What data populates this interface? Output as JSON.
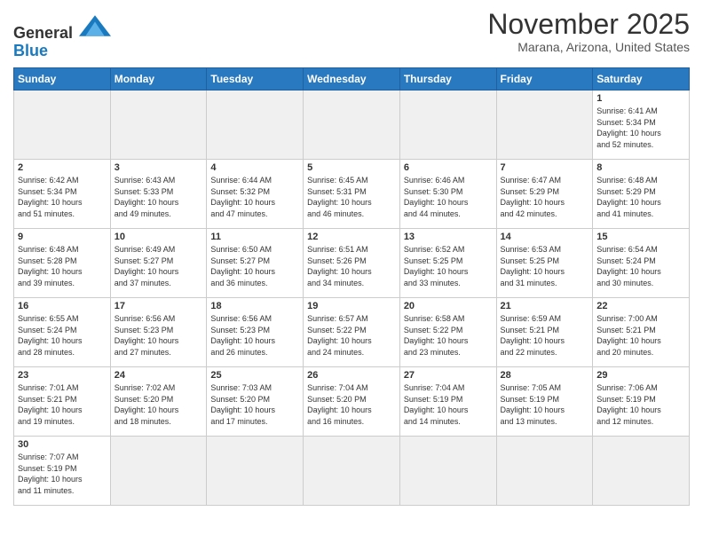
{
  "header": {
    "logo_general": "General",
    "logo_blue": "Blue",
    "month_title": "November 2025",
    "location": "Marana, Arizona, United States"
  },
  "days_of_week": [
    "Sunday",
    "Monday",
    "Tuesday",
    "Wednesday",
    "Thursday",
    "Friday",
    "Saturday"
  ],
  "weeks": [
    [
      {
        "day": null,
        "info": null
      },
      {
        "day": null,
        "info": null
      },
      {
        "day": null,
        "info": null
      },
      {
        "day": null,
        "info": null
      },
      {
        "day": null,
        "info": null
      },
      {
        "day": null,
        "info": null
      },
      {
        "day": "1",
        "info": "Sunrise: 6:41 AM\nSunset: 5:34 PM\nDaylight: 10 hours\nand 52 minutes."
      }
    ],
    [
      {
        "day": "2",
        "info": "Sunrise: 6:42 AM\nSunset: 5:34 PM\nDaylight: 10 hours\nand 51 minutes."
      },
      {
        "day": "3",
        "info": "Sunrise: 6:43 AM\nSunset: 5:33 PM\nDaylight: 10 hours\nand 49 minutes."
      },
      {
        "day": "4",
        "info": "Sunrise: 6:44 AM\nSunset: 5:32 PM\nDaylight: 10 hours\nand 47 minutes."
      },
      {
        "day": "5",
        "info": "Sunrise: 6:45 AM\nSunset: 5:31 PM\nDaylight: 10 hours\nand 46 minutes."
      },
      {
        "day": "6",
        "info": "Sunrise: 6:46 AM\nSunset: 5:30 PM\nDaylight: 10 hours\nand 44 minutes."
      },
      {
        "day": "7",
        "info": "Sunrise: 6:47 AM\nSunset: 5:29 PM\nDaylight: 10 hours\nand 42 minutes."
      },
      {
        "day": "8",
        "info": "Sunrise: 6:48 AM\nSunset: 5:29 PM\nDaylight: 10 hours\nand 41 minutes."
      }
    ],
    [
      {
        "day": "9",
        "info": "Sunrise: 6:48 AM\nSunset: 5:28 PM\nDaylight: 10 hours\nand 39 minutes."
      },
      {
        "day": "10",
        "info": "Sunrise: 6:49 AM\nSunset: 5:27 PM\nDaylight: 10 hours\nand 37 minutes."
      },
      {
        "day": "11",
        "info": "Sunrise: 6:50 AM\nSunset: 5:27 PM\nDaylight: 10 hours\nand 36 minutes."
      },
      {
        "day": "12",
        "info": "Sunrise: 6:51 AM\nSunset: 5:26 PM\nDaylight: 10 hours\nand 34 minutes."
      },
      {
        "day": "13",
        "info": "Sunrise: 6:52 AM\nSunset: 5:25 PM\nDaylight: 10 hours\nand 33 minutes."
      },
      {
        "day": "14",
        "info": "Sunrise: 6:53 AM\nSunset: 5:25 PM\nDaylight: 10 hours\nand 31 minutes."
      },
      {
        "day": "15",
        "info": "Sunrise: 6:54 AM\nSunset: 5:24 PM\nDaylight: 10 hours\nand 30 minutes."
      }
    ],
    [
      {
        "day": "16",
        "info": "Sunrise: 6:55 AM\nSunset: 5:24 PM\nDaylight: 10 hours\nand 28 minutes."
      },
      {
        "day": "17",
        "info": "Sunrise: 6:56 AM\nSunset: 5:23 PM\nDaylight: 10 hours\nand 27 minutes."
      },
      {
        "day": "18",
        "info": "Sunrise: 6:56 AM\nSunset: 5:23 PM\nDaylight: 10 hours\nand 26 minutes."
      },
      {
        "day": "19",
        "info": "Sunrise: 6:57 AM\nSunset: 5:22 PM\nDaylight: 10 hours\nand 24 minutes."
      },
      {
        "day": "20",
        "info": "Sunrise: 6:58 AM\nSunset: 5:22 PM\nDaylight: 10 hours\nand 23 minutes."
      },
      {
        "day": "21",
        "info": "Sunrise: 6:59 AM\nSunset: 5:21 PM\nDaylight: 10 hours\nand 22 minutes."
      },
      {
        "day": "22",
        "info": "Sunrise: 7:00 AM\nSunset: 5:21 PM\nDaylight: 10 hours\nand 20 minutes."
      }
    ],
    [
      {
        "day": "23",
        "info": "Sunrise: 7:01 AM\nSunset: 5:21 PM\nDaylight: 10 hours\nand 19 minutes."
      },
      {
        "day": "24",
        "info": "Sunrise: 7:02 AM\nSunset: 5:20 PM\nDaylight: 10 hours\nand 18 minutes."
      },
      {
        "day": "25",
        "info": "Sunrise: 7:03 AM\nSunset: 5:20 PM\nDaylight: 10 hours\nand 17 minutes."
      },
      {
        "day": "26",
        "info": "Sunrise: 7:04 AM\nSunset: 5:20 PM\nDaylight: 10 hours\nand 16 minutes."
      },
      {
        "day": "27",
        "info": "Sunrise: 7:04 AM\nSunset: 5:19 PM\nDaylight: 10 hours\nand 14 minutes."
      },
      {
        "day": "28",
        "info": "Sunrise: 7:05 AM\nSunset: 5:19 PM\nDaylight: 10 hours\nand 13 minutes."
      },
      {
        "day": "29",
        "info": "Sunrise: 7:06 AM\nSunset: 5:19 PM\nDaylight: 10 hours\nand 12 minutes."
      }
    ],
    [
      {
        "day": "30",
        "info": "Sunrise: 7:07 AM\nSunset: 5:19 PM\nDaylight: 10 hours\nand 11 minutes."
      },
      {
        "day": null,
        "info": null
      },
      {
        "day": null,
        "info": null
      },
      {
        "day": null,
        "info": null
      },
      {
        "day": null,
        "info": null
      },
      {
        "day": null,
        "info": null
      },
      {
        "day": null,
        "info": null
      }
    ]
  ]
}
